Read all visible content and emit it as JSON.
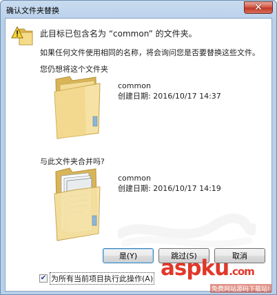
{
  "window": {
    "title": "确认文件夹替换",
    "close_label": "✕"
  },
  "message": {
    "heading": "此目标已包含名为 “common” 的文件夹。",
    "info": "如果任何文件使用相同的名称，将会询问您是否要替换这些文件。",
    "question": "您仍想将这个文件夹"
  },
  "destination_folder": {
    "name": "common",
    "date": "创建日期: 2016/10/17 14:37"
  },
  "merge_question": "与此文件夹合并吗?",
  "source_folder": {
    "name": "common",
    "date": "创建日期: 2016/10/17 14:19"
  },
  "buttons": {
    "yes": "是(Y)",
    "skip": "跳过(S)",
    "cancel": "取消"
  },
  "checkbox": {
    "label": "为所有当前项目执行此操作(A)",
    "checked": true
  },
  "watermark": {
    "main": "aspku",
    "dot": ".com",
    "sub": "免费网站源码下载站!"
  },
  "icons": {
    "warning": "warning-icon",
    "folder_empty": "folder-icon",
    "folder_full": "folder-with-files-icon"
  },
  "colors": {
    "title_bar": "#b8d0ea",
    "close_button": "#c03a26",
    "folder": "#f2d27a",
    "watermark_red": "#e0382a"
  }
}
